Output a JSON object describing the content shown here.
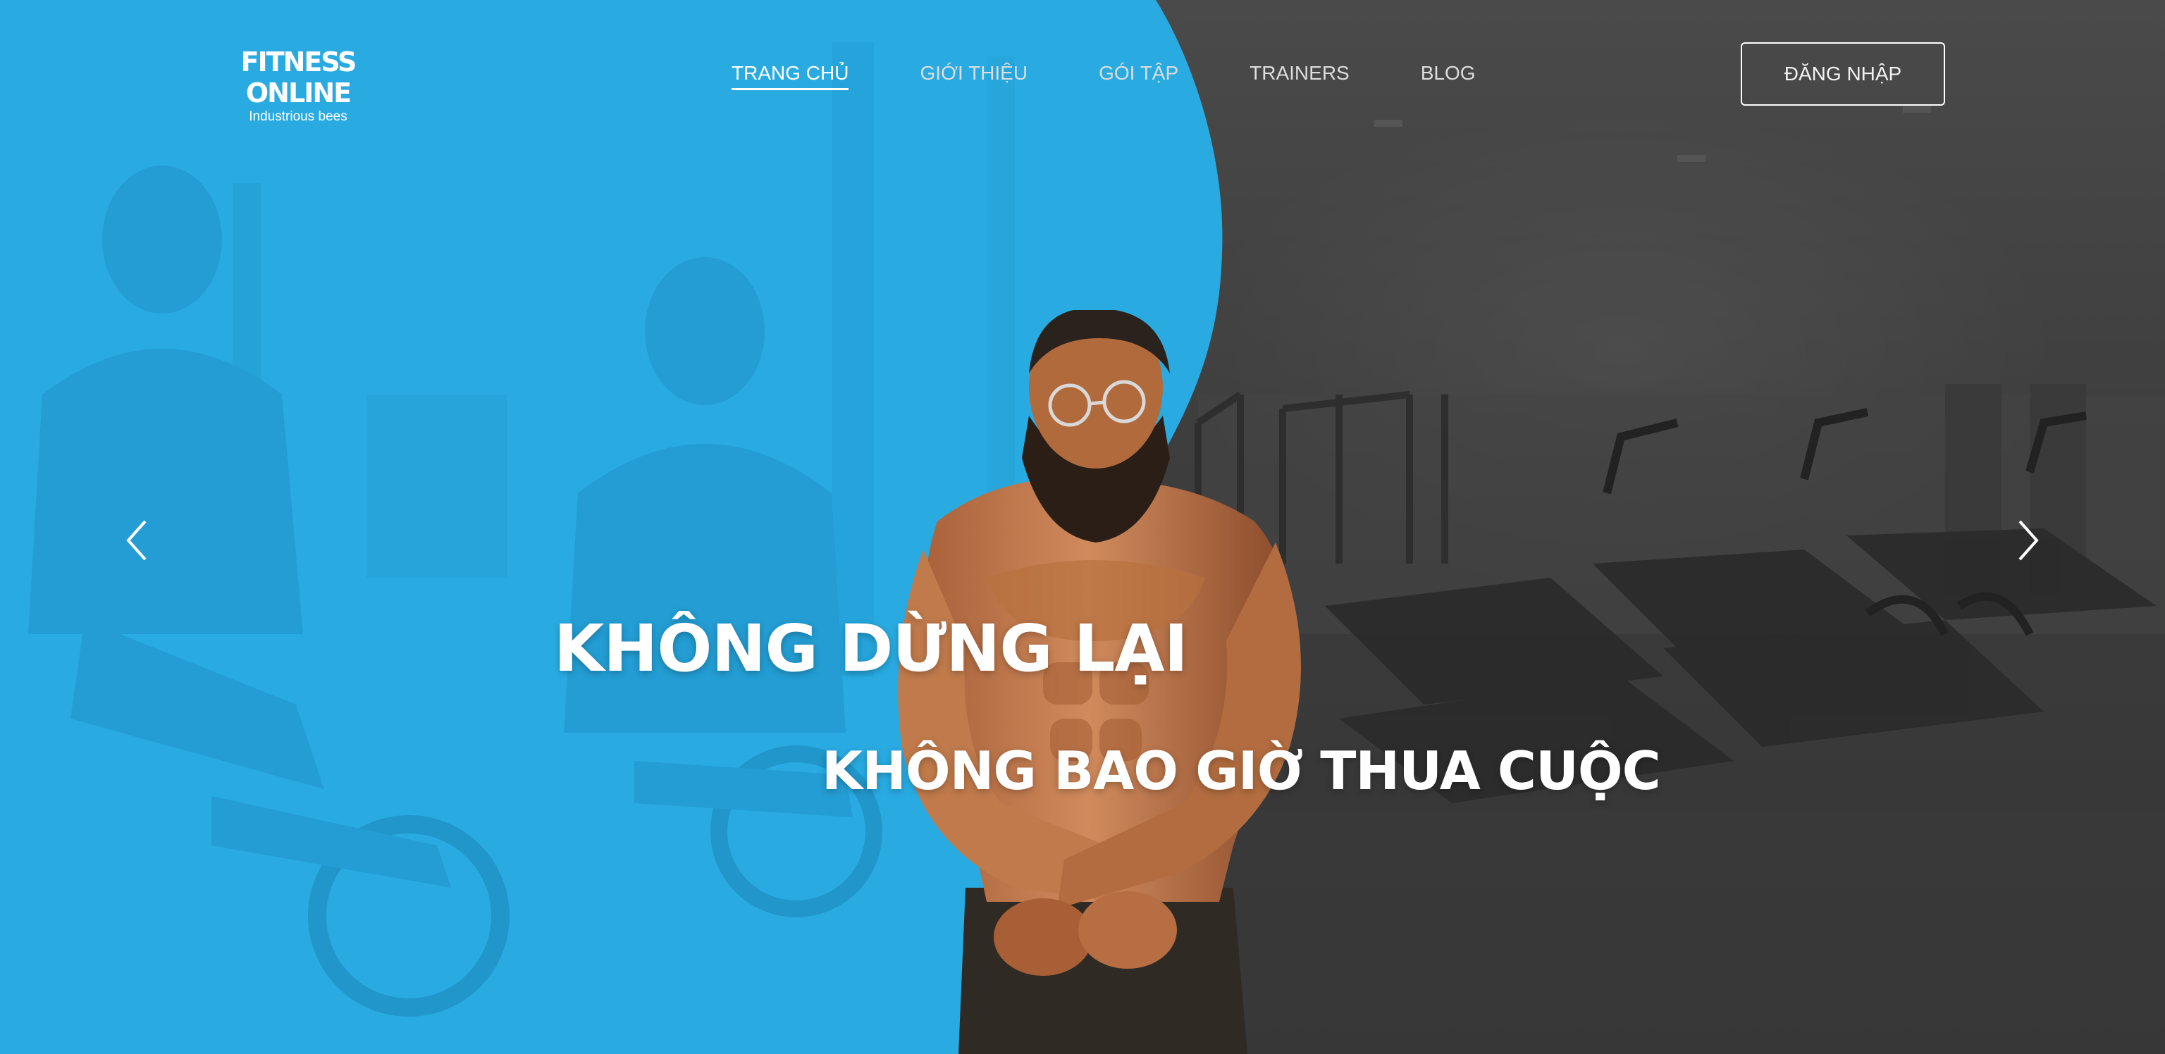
{
  "brand": {
    "name": "FITNESS ONLINE",
    "tagline": "Industrious bees"
  },
  "nav": {
    "items": [
      {
        "label": "TRANG CHỦ",
        "active": true
      },
      {
        "label": "GIỚI THIỆU",
        "active": false
      },
      {
        "label": "GÓI TẬP",
        "active": false
      },
      {
        "label": "TRAINERS",
        "active": false
      },
      {
        "label": "BLOG",
        "active": false
      }
    ]
  },
  "header": {
    "login_label": "ĐĂNG NHẬP"
  },
  "hero": {
    "headline_1": "KHÔNG DỪNG LẠI",
    "headline_2": "KHÔNG BAO GIỜ THUA CUỘC",
    "left_panel_color": "#29abe2",
    "right_panel_color": "#3c3c3c"
  },
  "carousel": {
    "prev_icon": "chevron-left-icon",
    "next_icon": "chevron-right-icon"
  }
}
